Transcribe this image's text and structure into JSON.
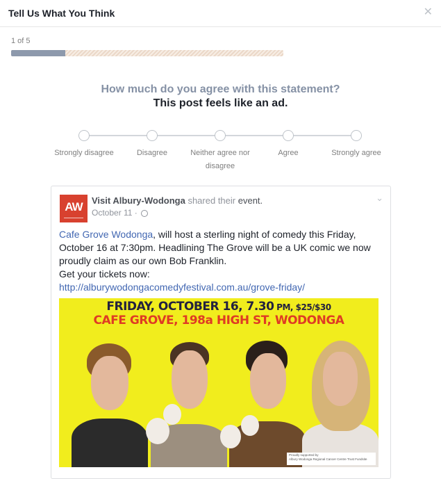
{
  "dialog": {
    "title": "Tell Us What You Think",
    "close_icon": "close-icon"
  },
  "survey": {
    "counter": "1 of 5",
    "progress_fraction": 0.2,
    "question": "How much do you agree with this statement?",
    "statement": "This post feels like an ad.",
    "options": [
      "Strongly disagree",
      "Disagree",
      "Neither agree nor disagree",
      "Agree",
      "Strongly agree"
    ]
  },
  "post": {
    "page_name": "Visit Albury-Wodonga",
    "action_text": "shared their",
    "event_text": "event.",
    "date": "October 11 ·",
    "avatar_text": "AW",
    "body": {
      "mention": "Cafe Grove Wodonga",
      "text": ", will host a sterling night of comedy this Friday, October 16 at 7:30pm. Headlining The Grove will be a UK comic we now proudly claim as our own Bob Franklin.",
      "cta": "Get your tickets now:",
      "link": "http://alburywodongacomedyfestival.com.au/grove-friday/"
    },
    "poster": {
      "line1": "FRIDAY, OCTOBER 16, 7.30",
      "line1_suffix": " PM, $25/$30",
      "line2": "CAFE GROVE, 198a HIGH ST, WODONGA",
      "credit_small": "Proudly supported by",
      "credit": "Albury Wodonga Regional Cancer Centre Trust Fundsite",
      "background": "#f1ed1d"
    }
  },
  "colors": {
    "accent_gray": "#8591a5",
    "link_blue": "#4267b2",
    "avatar_red": "#d8412f",
    "poster_red": "#df3b24"
  }
}
